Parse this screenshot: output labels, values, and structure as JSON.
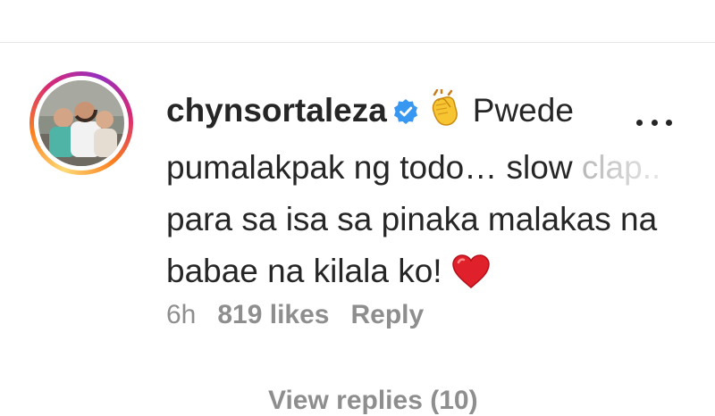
{
  "comment": {
    "username": "chynsortaleza",
    "text_line1_rest": "Pwede",
    "text_line2": "pumalakpak ng todo… slow",
    "text_line2_faded": "clap..",
    "text_line3": "para sa isa sa pinaka malakas na",
    "text_line4": "babae na kilala ko!",
    "emoji_clap": "clapping-hands-emoji",
    "emoji_heart": "red-heart-emoji",
    "verified_icon": "verified-badge-icon",
    "verified_color": "#3897f0",
    "avatar_ring_colors": [
      "#feda75",
      "#fa7e1e",
      "#d62976",
      "#962fbf"
    ]
  },
  "meta": {
    "time": "6h",
    "likes": "819 likes",
    "reply": "Reply"
  },
  "view_replies": "View replies (10)",
  "more_icon": "more-options-icon"
}
